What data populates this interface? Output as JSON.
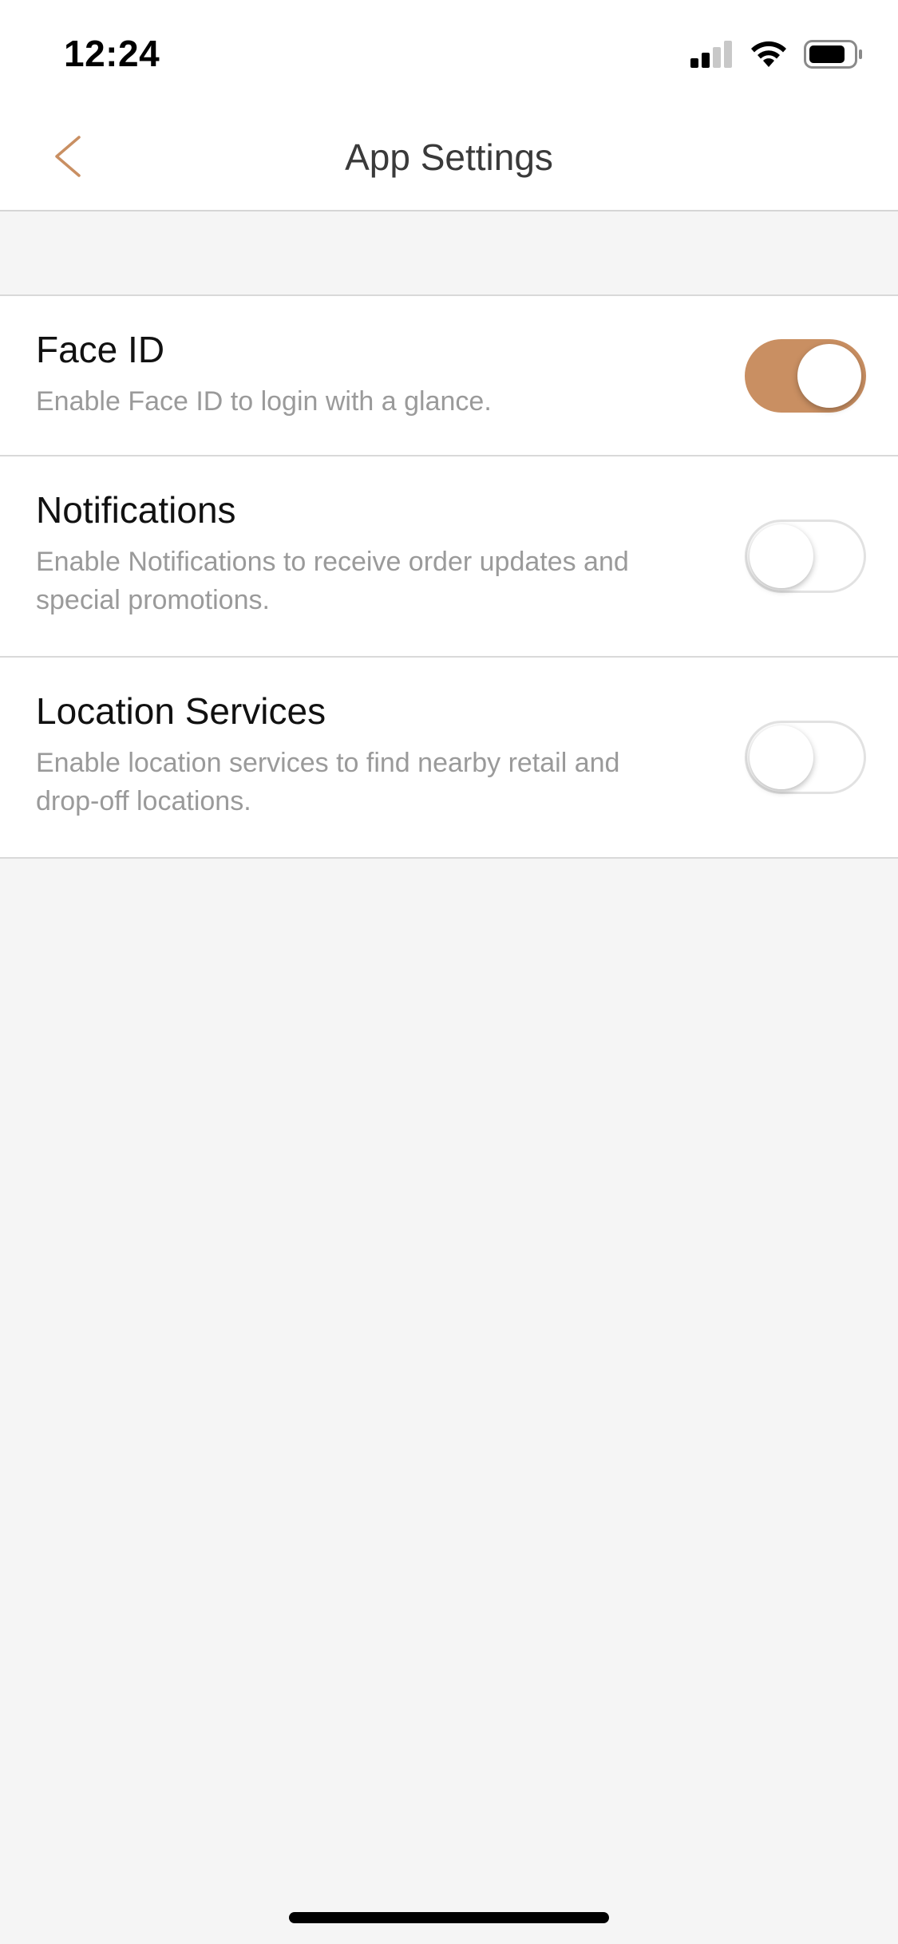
{
  "status_bar": {
    "time": "12:24",
    "icons": [
      "cellular-signal-icon",
      "wifi-icon",
      "battery-icon"
    ]
  },
  "nav": {
    "title": "App Settings",
    "back_icon": "chevron-left-icon"
  },
  "settings": [
    {
      "title": "Face ID",
      "description": "Enable Face ID to login with a glance.",
      "enabled": true
    },
    {
      "title": "Notifications",
      "description": "Enable Notifications to receive order updates and special promotions.",
      "enabled": false
    },
    {
      "title": "Location Services",
      "description": "Enable location services to find nearby retail and drop-off locations.",
      "enabled": false
    }
  ],
  "colors": {
    "accent": "#c98f62",
    "background": "#f5f5f5",
    "title_text": "#111111",
    "description_text": "#9a9a9a",
    "divider": "#d9d9d9"
  }
}
